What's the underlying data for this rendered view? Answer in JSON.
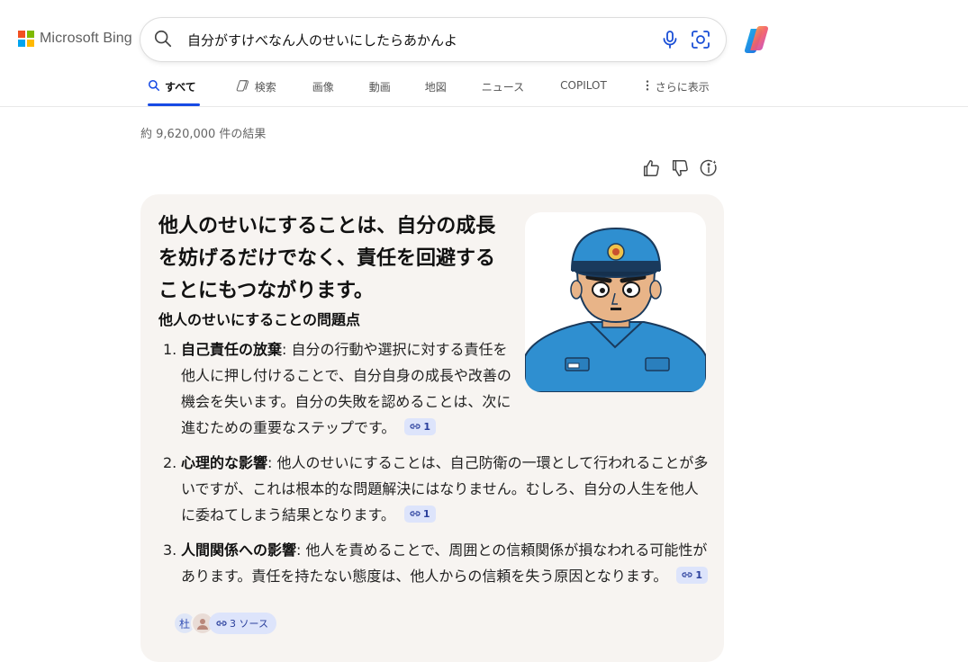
{
  "brand": {
    "name": "Microsoft Bing",
    "colors": [
      "#f25022",
      "#7fba00",
      "#00a4ef",
      "#ffb900"
    ]
  },
  "search": {
    "query": "自分がすけべなん人のせいにしたらあかんよ"
  },
  "tabs": [
    {
      "label": "すべて",
      "icon": "search-icon",
      "active": true
    },
    {
      "label": "検索",
      "icon": "copilot-search-icon",
      "active": false
    },
    {
      "label": "画像",
      "active": false
    },
    {
      "label": "動画",
      "active": false
    },
    {
      "label": "地図",
      "active": false
    },
    {
      "label": "ニュース",
      "active": false
    },
    {
      "label": "COPILOT",
      "active": false
    },
    {
      "label": "さらに表示",
      "icon": "more-vertical-icon",
      "active": false
    }
  ],
  "results": {
    "count_text": "約 9,620,000 件の結果"
  },
  "feedback": {
    "icons": [
      "thumbs-up-icon",
      "thumbs-down-icon",
      "info-icon"
    ]
  },
  "answer": {
    "headline": "他人のせいにすることは、自分の成長を妨げるだけでなく、責任を回避することにもつながります。",
    "subheading": "他人のせいにすることの問題点",
    "items": [
      {
        "number": "1.",
        "title": "自己責任の放棄",
        "text": ": 自分の行動や選択に対する責任を他人に押し付けることで、自分自身の成長や改善の機会を失います。自分の失敗を認めることは、次に進むための重要なステップです。",
        "citation": "1"
      },
      {
        "number": "2.",
        "title": "心理的な影響",
        "text": ": 他人のせいにすることは、自己防衛の一環として行われることが多いですが、これは根本的な問題解決にはなりません。むしろ、自分の人生を他人に委ねてしまう結果となります。",
        "citation": "1"
      },
      {
        "number": "3.",
        "title": "人間関係への影響",
        "text": ": 他人を責めることで、周囲との信頼関係が損なわれる可能性があります。責任を持たない態度は、他人からの信頼を失う原因となります。",
        "citation": "1"
      }
    ],
    "sources": {
      "avatar_char": "杜",
      "label": "3 ソース"
    }
  }
}
